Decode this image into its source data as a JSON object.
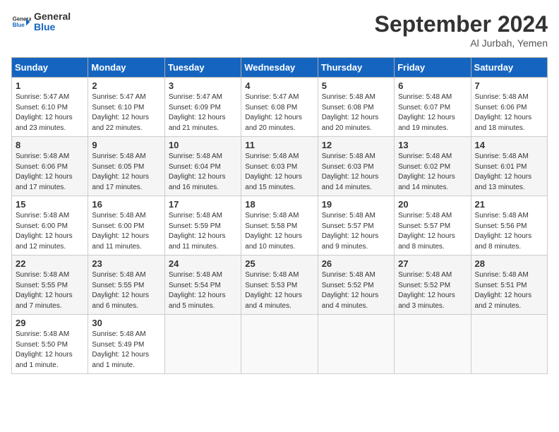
{
  "header": {
    "logo_line1": "General",
    "logo_line2": "Blue",
    "month": "September 2024",
    "location": "Al Jurbah, Yemen"
  },
  "columns": [
    "Sunday",
    "Monday",
    "Tuesday",
    "Wednesday",
    "Thursday",
    "Friday",
    "Saturday"
  ],
  "weeks": [
    [
      {
        "day": "1",
        "sunrise": "5:47 AM",
        "sunset": "6:10 PM",
        "daylight": "12 hours and 23 minutes."
      },
      {
        "day": "2",
        "sunrise": "5:47 AM",
        "sunset": "6:10 PM",
        "daylight": "12 hours and 22 minutes."
      },
      {
        "day": "3",
        "sunrise": "5:47 AM",
        "sunset": "6:09 PM",
        "daylight": "12 hours and 21 minutes."
      },
      {
        "day": "4",
        "sunrise": "5:47 AM",
        "sunset": "6:08 PM",
        "daylight": "12 hours and 20 minutes."
      },
      {
        "day": "5",
        "sunrise": "5:48 AM",
        "sunset": "6:08 PM",
        "daylight": "12 hours and 20 minutes."
      },
      {
        "day": "6",
        "sunrise": "5:48 AM",
        "sunset": "6:07 PM",
        "daylight": "12 hours and 19 minutes."
      },
      {
        "day": "7",
        "sunrise": "5:48 AM",
        "sunset": "6:06 PM",
        "daylight": "12 hours and 18 minutes."
      }
    ],
    [
      {
        "day": "8",
        "sunrise": "5:48 AM",
        "sunset": "6:06 PM",
        "daylight": "12 hours and 17 minutes."
      },
      {
        "day": "9",
        "sunrise": "5:48 AM",
        "sunset": "6:05 PM",
        "daylight": "12 hours and 17 minutes."
      },
      {
        "day": "10",
        "sunrise": "5:48 AM",
        "sunset": "6:04 PM",
        "daylight": "12 hours and 16 minutes."
      },
      {
        "day": "11",
        "sunrise": "5:48 AM",
        "sunset": "6:03 PM",
        "daylight": "12 hours and 15 minutes."
      },
      {
        "day": "12",
        "sunrise": "5:48 AM",
        "sunset": "6:03 PM",
        "daylight": "12 hours and 14 minutes."
      },
      {
        "day": "13",
        "sunrise": "5:48 AM",
        "sunset": "6:02 PM",
        "daylight": "12 hours and 14 minutes."
      },
      {
        "day": "14",
        "sunrise": "5:48 AM",
        "sunset": "6:01 PM",
        "daylight": "12 hours and 13 minutes."
      }
    ],
    [
      {
        "day": "15",
        "sunrise": "5:48 AM",
        "sunset": "6:00 PM",
        "daylight": "12 hours and 12 minutes."
      },
      {
        "day": "16",
        "sunrise": "5:48 AM",
        "sunset": "6:00 PM",
        "daylight": "12 hours and 11 minutes."
      },
      {
        "day": "17",
        "sunrise": "5:48 AM",
        "sunset": "5:59 PM",
        "daylight": "12 hours and 11 minutes."
      },
      {
        "day": "18",
        "sunrise": "5:48 AM",
        "sunset": "5:58 PM",
        "daylight": "12 hours and 10 minutes."
      },
      {
        "day": "19",
        "sunrise": "5:48 AM",
        "sunset": "5:57 PM",
        "daylight": "12 hours and 9 minutes."
      },
      {
        "day": "20",
        "sunrise": "5:48 AM",
        "sunset": "5:57 PM",
        "daylight": "12 hours and 8 minutes."
      },
      {
        "day": "21",
        "sunrise": "5:48 AM",
        "sunset": "5:56 PM",
        "daylight": "12 hours and 8 minutes."
      }
    ],
    [
      {
        "day": "22",
        "sunrise": "5:48 AM",
        "sunset": "5:55 PM",
        "daylight": "12 hours and 7 minutes."
      },
      {
        "day": "23",
        "sunrise": "5:48 AM",
        "sunset": "5:55 PM",
        "daylight": "12 hours and 6 minutes."
      },
      {
        "day": "24",
        "sunrise": "5:48 AM",
        "sunset": "5:54 PM",
        "daylight": "12 hours and 5 minutes."
      },
      {
        "day": "25",
        "sunrise": "5:48 AM",
        "sunset": "5:53 PM",
        "daylight": "12 hours and 4 minutes."
      },
      {
        "day": "26",
        "sunrise": "5:48 AM",
        "sunset": "5:52 PM",
        "daylight": "12 hours and 4 minutes."
      },
      {
        "day": "27",
        "sunrise": "5:48 AM",
        "sunset": "5:52 PM",
        "daylight": "12 hours and 3 minutes."
      },
      {
        "day": "28",
        "sunrise": "5:48 AM",
        "sunset": "5:51 PM",
        "daylight": "12 hours and 2 minutes."
      }
    ],
    [
      {
        "day": "29",
        "sunrise": "5:48 AM",
        "sunset": "5:50 PM",
        "daylight": "12 hours and 1 minute."
      },
      {
        "day": "30",
        "sunrise": "5:48 AM",
        "sunset": "5:49 PM",
        "daylight": "12 hours and 1 minute."
      },
      null,
      null,
      null,
      null,
      null
    ]
  ],
  "labels": {
    "sunrise": "Sunrise:",
    "sunset": "Sunset:",
    "daylight": "Daylight:"
  }
}
